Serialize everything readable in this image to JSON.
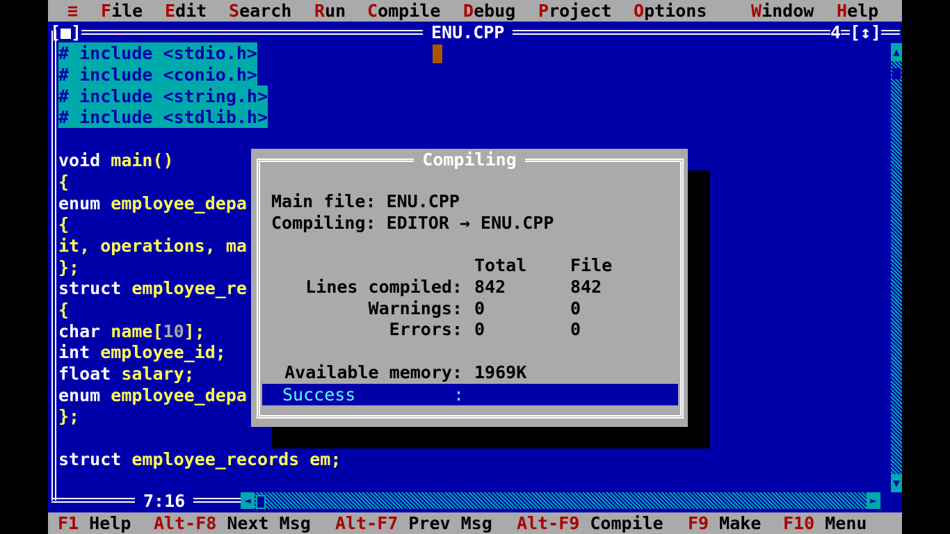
{
  "menu": [
    {
      "label": "≡",
      "hotkey": "",
      "rest": "≡"
    },
    {
      "label": "File",
      "hotkey": "F",
      "rest": "ile"
    },
    {
      "label": "Edit",
      "hotkey": "E",
      "rest": "dit"
    },
    {
      "label": "Search",
      "hotkey": "S",
      "rest": "earch"
    },
    {
      "label": "Run",
      "hotkey": "R",
      "rest": "un"
    },
    {
      "label": "Compile",
      "hotkey": "C",
      "rest": "ompile"
    },
    {
      "label": "Debug",
      "hotkey": "D",
      "rest": "ebug"
    },
    {
      "label": "Project",
      "hotkey": "P",
      "rest": "roject"
    },
    {
      "label": "Options",
      "hotkey": "O",
      "rest": "ptions"
    },
    {
      "label": "Window",
      "hotkey": "W",
      "rest": "indow"
    },
    {
      "label": "Help",
      "hotkey": "H",
      "rest": "elp"
    }
  ],
  "editor": {
    "close_box": "[■]",
    "filename": "ENU.CPP",
    "window_number": "4",
    "zoom_box": "[↕]",
    "position": "7:16",
    "lines": {
      "inc1": "# include <stdio.h>",
      "inc2": "# include <conio.h>",
      "inc3": "# include <string.h>",
      "inc4": "# include <stdlib.h>",
      "l6_kw": "void",
      "l6_id": " main()",
      "l7": "{",
      "l8_kw": "enum",
      "l8_id": " employee_depa",
      "l9": "{",
      "l10": "it, operations, ma",
      "l11": "};",
      "l12_kw": "struct",
      "l12_id": " employee_re",
      "l13": "{",
      "l14_kw": "char",
      "l14_id": " name[",
      "l14_num": "10",
      "l14_end": "];",
      "l15_kw": "int",
      "l15_id": " employee_id;",
      "l16_kw": "float",
      "l16_id": " salary;",
      "l17_kw": "enum",
      "l17_id": " employee_depa",
      "l18": "};",
      "l20_kw": "struct",
      "l20_id": " employee_records em;"
    }
  },
  "dialog": {
    "title": "Compiling",
    "main_file_label": "Main file: ENU.CPP",
    "compiling_label": "Compiling: EDITOR → ENU.CPP",
    "col_total": "Total",
    "col_file": "File",
    "rows": [
      {
        "label": "Lines compiled:",
        "total": "842",
        "file": "842"
      },
      {
        "label": "Warnings:",
        "total": "0",
        "file": "0"
      },
      {
        "label": "Errors:",
        "total": "0",
        "file": "0"
      }
    ],
    "memory_label": "Available memory:",
    "memory_value": "1969K",
    "status_label": "Success",
    "status_sep": ":"
  },
  "helpbar": [
    {
      "key": "F1",
      "label": "Help"
    },
    {
      "key": "Alt-F8",
      "label": "Next Msg"
    },
    {
      "key": "Alt-F7",
      "label": "Prev Msg"
    },
    {
      "key": "Alt-F9",
      "label": "Compile"
    },
    {
      "key": "F9",
      "label": "Make"
    },
    {
      "key": "F10",
      "label": "Menu"
    }
  ],
  "colors": {
    "desktop_blue": "#0000AA",
    "menu_gray": "#AAAAAA",
    "hotkey_red": "#AA0000",
    "identifier_yellow": "#FFFF55",
    "selection_cyan": "#00AAAA",
    "cursor_brown": "#AA5500"
  }
}
